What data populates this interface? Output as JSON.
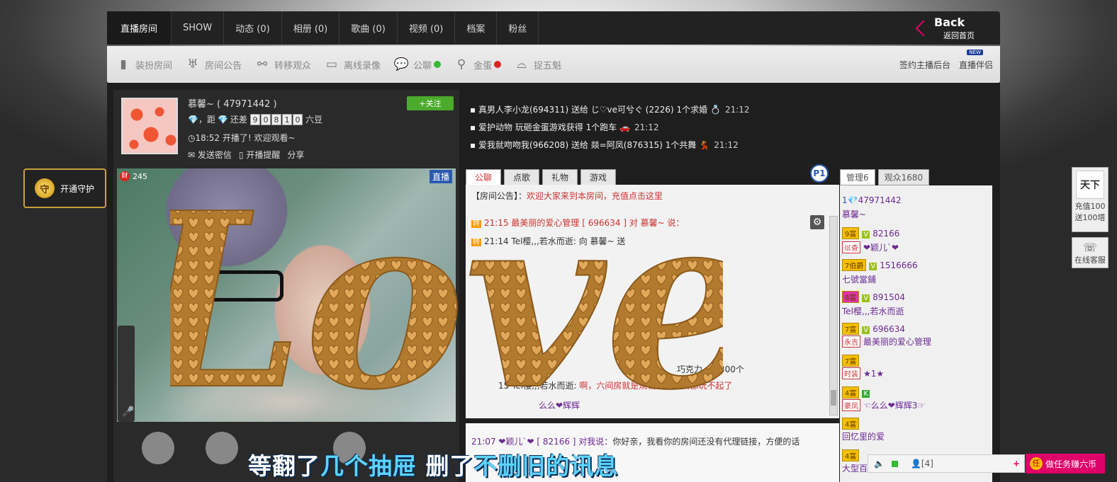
{
  "nav": {
    "tabs": [
      "直播房间",
      "SHOW",
      "动态 (0)",
      "相册 (0)",
      "歌曲 (0)",
      "视频 (0)",
      "档案",
      "粉丝"
    ],
    "back_label": "Back",
    "back_sub": "返回首页"
  },
  "toolbar": {
    "items": [
      {
        "label": "装扮房间",
        "icon": "dress-room-icon"
      },
      {
        "label": "房间公告",
        "icon": "antenna-icon"
      },
      {
        "label": "转移观众",
        "icon": "link-icon"
      },
      {
        "label": "离线录像",
        "icon": "monitor-icon"
      },
      {
        "label": "公聊",
        "icon": "chat-bubble-icon"
      },
      {
        "label": "金蛋",
        "icon": "location-pin-icon"
      },
      {
        "label": "捉五魁",
        "icon": "hat-icon"
      }
    ],
    "right_items": [
      "签约主播后台",
      "直播伴侣"
    ],
    "new_badge": "NEW"
  },
  "streamer": {
    "name": "慕馨~ ( 47971442 )",
    "rank_text": "，距",
    "remaining_label": "还差",
    "digits": [
      "9",
      "0",
      "8",
      "1",
      "0"
    ],
    "unit": "六豆",
    "status": "18:52 开播了! 欢迎观看~",
    "actions": [
      "发送密信",
      "开播提醒",
      "分享"
    ],
    "follow_label": "+关注"
  },
  "video": {
    "live_tag": "直播",
    "cai_count": "245",
    "cai_char": "财"
  },
  "gifts": [
    {
      "text": "真男人李小龙(694311) 送给 じ♡ve可兮ぐ (2226) 1个求婚",
      "time": "21:12"
    },
    {
      "text": "爱护动物 玩砸金蛋游戏获得 1个跑车",
      "time": "21:12"
    },
    {
      "text": "爱我就吻吻我(966208) 送给 燚=阿凤(876315) 1个共舞",
      "time": "21:12"
    }
  ],
  "chat": {
    "tabs": [
      "公聊",
      "点歌",
      "礼物",
      "游戏"
    ],
    "p_badge": "P1",
    "announce_label": "【房间公告】：",
    "announce_text": "欢迎大家来到本房间，充值点击这里",
    "line1": "21:15 最美丽的爱心管理 [ 696634 ] 对 慕馨~ 说：",
    "line2": "21:14 Tel樱,,,若水而逝: 向 慕馨~ 送",
    "line3": "巧克力，共300个",
    "line4a": "15 Tel樱,,,若水而逝: ",
    "line4b": "啊，六间房就是烧钱啊，穷货都玩不起了",
    "line5": "么么❤辉辉",
    "line6a": "21:07 ❤颖儿`❤ [ 82166 ] 对我说：",
    "line6b": "你好亲，我看你的房间还没有代理链接，方便的话"
  },
  "right": {
    "tabs": [
      "管理6",
      "观众1680"
    ],
    "users": [
      {
        "id": "47971442",
        "name": "慕馨~"
      },
      {
        "lv": "9富",
        "vip": "V",
        "id": "82166",
        "tag": "巛查",
        "name": "❤颖儿`❤"
      },
      {
        "lv": "7伯爵",
        "vip": "V",
        "id": "1516666",
        "name": "七號當鋪"
      },
      {
        "lv": "8富",
        "vip": "V",
        "id": "891504",
        "name": "Tel樱,,,若水而逝"
      },
      {
        "lv": "7富",
        "vip": "V",
        "id": "696634",
        "tag": "永吉",
        "name": "最美丽的爱心管理"
      },
      {
        "lv": "7富",
        "tag": "时装",
        "name": "★1★"
      },
      {
        "lv": "4富",
        "vip": "K",
        "tag": "豪凤",
        "name": "☜么么❤辉辉3☞"
      },
      {
        "lv": "4富",
        "name": "回忆里的爱"
      },
      {
        "lv": "4富",
        "name": "大型百"
      }
    ]
  },
  "side": {
    "guard_label": "开通守护",
    "guard_icon_char": "守",
    "recharge_logo": "天下",
    "recharge_line1": "充值100",
    "recharge_line2": "送100塔",
    "service_label": "在线客服"
  },
  "bottom": {
    "count": "[4]",
    "task_label": "做任务赚六币",
    "task_char": "任"
  },
  "overlay": {
    "love_text": "Love",
    "caption_a": "等翻了",
    "caption_b": "几个抽屉",
    "caption_c": "删了",
    "caption_d": "不删旧的讯息"
  },
  "colors": {
    "accent_pink": "#e0006a",
    "follow_green": "#4caa2c",
    "gold": "#c8a040"
  }
}
